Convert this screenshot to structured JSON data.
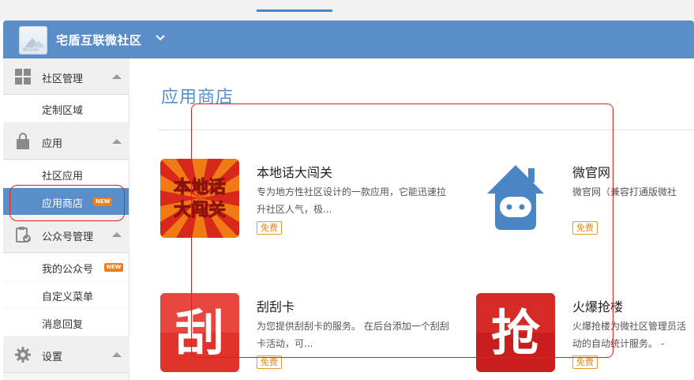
{
  "header": {
    "community_name": "宅盾互联微社区",
    "logo_caption": "微社区logo"
  },
  "sidebar": {
    "groups": [
      {
        "label": "社区管理",
        "icon": "grid-icon",
        "items": [
          {
            "label": "定制区域"
          }
        ]
      },
      {
        "label": "应用",
        "icon": "bag-icon",
        "items": [
          {
            "label": "社区应用"
          },
          {
            "label": "应用商店",
            "badge": "NEW",
            "active": true
          }
        ]
      },
      {
        "label": "公众号管理",
        "icon": "clipboard-check-icon",
        "items": [
          {
            "label": "我的公众号",
            "badge": "NEW"
          },
          {
            "label": "自定义菜单"
          },
          {
            "label": "消息回复"
          }
        ]
      },
      {
        "label": "设置",
        "icon": "gear-icon",
        "items": []
      }
    ]
  },
  "main": {
    "title": "应用商店",
    "apps": [
      {
        "name": "本地话大闯关",
        "desc": "专为地方性社区设计的一款应用，它能迅速拉升社区人气，极...",
        "price": "免费",
        "icon_text": [
          "本地话",
          "大闯关"
        ]
      },
      {
        "name": "微官网",
        "desc": "微官网（兼容打通版微社",
        "price": "免费"
      },
      {
        "name": "刮刮卡",
        "desc": "为您提供刮刮卡的服务。 在后台添加一个刮刮卡活动，可...",
        "price": "免费",
        "icon_text": "刮"
      },
      {
        "name": "火爆抢楼",
        "desc": "火爆抢楼为微社区管理员活动的自动统计服务。 -",
        "price": "免费",
        "icon_text": "抢"
      }
    ]
  },
  "colors": {
    "header_bg": "#5a8ec9",
    "active_item": "#5a8ec9",
    "badge": "#f07d1a",
    "free_tag": "#e08918",
    "annotation": "#d8231f"
  }
}
